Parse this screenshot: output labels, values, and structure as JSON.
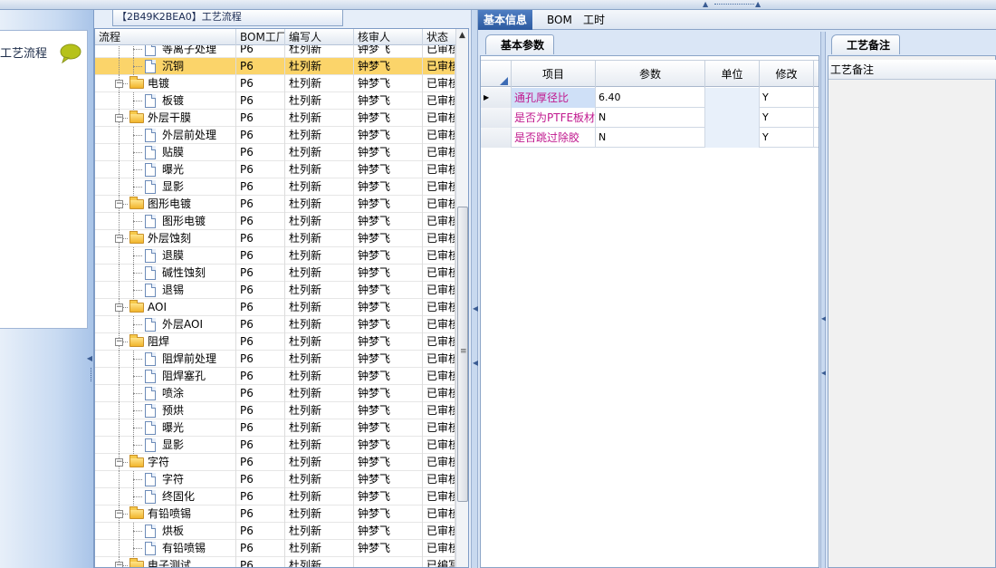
{
  "left_panel": {
    "title": "工艺流程",
    "icon": "speech-bubble-icon"
  },
  "tree_panel": {
    "header": "【2B49K2BEA0】工艺流程",
    "columns": [
      "流程",
      "BOM工厂",
      "编写人",
      "核审人",
      "状态"
    ],
    "rows": [
      {
        "level": 1,
        "type": "doc",
        "name": "等离子处理",
        "bom": "P6",
        "writer": "杜列新",
        "reviewer": "钟梦飞",
        "status": "已审核"
      },
      {
        "level": 1,
        "type": "doc",
        "name": "沉铜",
        "bom": "P6",
        "writer": "杜列新",
        "reviewer": "钟梦飞",
        "status": "已审核",
        "selected": true
      },
      {
        "level": 0,
        "type": "folder",
        "name": "电镀",
        "bom": "P6",
        "writer": "杜列新",
        "reviewer": "钟梦飞",
        "status": "已审核"
      },
      {
        "level": 1,
        "type": "doc",
        "name": "板镀",
        "bom": "P6",
        "writer": "杜列新",
        "reviewer": "钟梦飞",
        "status": "已审核"
      },
      {
        "level": 0,
        "type": "folder",
        "name": "外层干膜",
        "bom": "P6",
        "writer": "杜列新",
        "reviewer": "钟梦飞",
        "status": "已审核"
      },
      {
        "level": 1,
        "type": "doc",
        "name": "外层前处理",
        "bom": "P6",
        "writer": "杜列新",
        "reviewer": "钟梦飞",
        "status": "已审核"
      },
      {
        "level": 1,
        "type": "doc",
        "name": "贴膜",
        "bom": "P6",
        "writer": "杜列新",
        "reviewer": "钟梦飞",
        "status": "已审核"
      },
      {
        "level": 1,
        "type": "doc",
        "name": "曝光",
        "bom": "P6",
        "writer": "杜列新",
        "reviewer": "钟梦飞",
        "status": "已审核"
      },
      {
        "level": 1,
        "type": "doc",
        "name": "显影",
        "bom": "P6",
        "writer": "杜列新",
        "reviewer": "钟梦飞",
        "status": "已审核"
      },
      {
        "level": 0,
        "type": "folder",
        "name": "图形电镀",
        "bom": "P6",
        "writer": "杜列新",
        "reviewer": "钟梦飞",
        "status": "已审核"
      },
      {
        "level": 1,
        "type": "doc",
        "name": "图形电镀",
        "bom": "P6",
        "writer": "杜列新",
        "reviewer": "钟梦飞",
        "status": "已审核"
      },
      {
        "level": 0,
        "type": "folder",
        "name": "外层蚀刻",
        "bom": "P6",
        "writer": "杜列新",
        "reviewer": "钟梦飞",
        "status": "已审核"
      },
      {
        "level": 1,
        "type": "doc",
        "name": "退膜",
        "bom": "P6",
        "writer": "杜列新",
        "reviewer": "钟梦飞",
        "status": "已审核"
      },
      {
        "level": 1,
        "type": "doc",
        "name": "碱性蚀刻",
        "bom": "P6",
        "writer": "杜列新",
        "reviewer": "钟梦飞",
        "status": "已审核"
      },
      {
        "level": 1,
        "type": "doc",
        "name": "退锡",
        "bom": "P6",
        "writer": "杜列新",
        "reviewer": "钟梦飞",
        "status": "已审核"
      },
      {
        "level": 0,
        "type": "folder",
        "name": "AOI",
        "bom": "P6",
        "writer": "杜列新",
        "reviewer": "钟梦飞",
        "status": "已审核"
      },
      {
        "level": 1,
        "type": "doc",
        "name": "外层AOI",
        "bom": "P6",
        "writer": "杜列新",
        "reviewer": "钟梦飞",
        "status": "已审核"
      },
      {
        "level": 0,
        "type": "folder",
        "name": "阻焊",
        "bom": "P6",
        "writer": "杜列新",
        "reviewer": "钟梦飞",
        "status": "已审核"
      },
      {
        "level": 1,
        "type": "doc",
        "name": "阻焊前处理",
        "bom": "P6",
        "writer": "杜列新",
        "reviewer": "钟梦飞",
        "status": "已审核"
      },
      {
        "level": 1,
        "type": "doc",
        "name": "阻焊塞孔",
        "bom": "P6",
        "writer": "杜列新",
        "reviewer": "钟梦飞",
        "status": "已审核"
      },
      {
        "level": 1,
        "type": "doc",
        "name": "喷涂",
        "bom": "P6",
        "writer": "杜列新",
        "reviewer": "钟梦飞",
        "status": "已审核"
      },
      {
        "level": 1,
        "type": "doc",
        "name": "预烘",
        "bom": "P6",
        "writer": "杜列新",
        "reviewer": "钟梦飞",
        "status": "已审核"
      },
      {
        "level": 1,
        "type": "doc",
        "name": "曝光",
        "bom": "P6",
        "writer": "杜列新",
        "reviewer": "钟梦飞",
        "status": "已审核"
      },
      {
        "level": 1,
        "type": "doc",
        "name": "显影",
        "bom": "P6",
        "writer": "杜列新",
        "reviewer": "钟梦飞",
        "status": "已审核"
      },
      {
        "level": 0,
        "type": "folder",
        "name": "字符",
        "bom": "P6",
        "writer": "杜列新",
        "reviewer": "钟梦飞",
        "status": "已审核"
      },
      {
        "level": 1,
        "type": "doc",
        "name": "字符",
        "bom": "P6",
        "writer": "杜列新",
        "reviewer": "钟梦飞",
        "status": "已审核"
      },
      {
        "level": 1,
        "type": "doc",
        "name": "终固化",
        "bom": "P6",
        "writer": "杜列新",
        "reviewer": "钟梦飞",
        "status": "已审核"
      },
      {
        "level": 0,
        "type": "folder",
        "name": "有铅喷锡",
        "bom": "P6",
        "writer": "杜列新",
        "reviewer": "钟梦飞",
        "status": "已审核"
      },
      {
        "level": 1,
        "type": "doc",
        "name": "烘板",
        "bom": "P6",
        "writer": "杜列新",
        "reviewer": "钟梦飞",
        "status": "已审核"
      },
      {
        "level": 1,
        "type": "doc",
        "name": "有铅喷锡",
        "bom": "P6",
        "writer": "杜列新",
        "reviewer": "钟梦飞",
        "status": "已审核"
      },
      {
        "level": 0,
        "type": "folder",
        "name": "电子测试",
        "bom": "P6",
        "writer": "杜列新",
        "reviewer": "",
        "status": "已编写"
      }
    ]
  },
  "tabs": [
    {
      "label": "基本信息",
      "active": true
    },
    {
      "label": "BOM",
      "active": false
    },
    {
      "label": "工时",
      "active": false
    }
  ],
  "basic_params": {
    "tab_label": "基本参数",
    "columns": [
      "项目",
      "参数",
      "单位",
      "修改"
    ],
    "rows": [
      {
        "item": "通孔厚径比",
        "value": "6.40",
        "unit": "",
        "modify": "Y",
        "current": true
      },
      {
        "item": "是否为PTFE板材",
        "value": "N",
        "unit": "",
        "modify": "Y"
      },
      {
        "item": "是否跳过除胶",
        "value": "N",
        "unit": "",
        "modify": "Y"
      }
    ]
  },
  "notes": {
    "tab_label": "工艺备注",
    "field_label": "工艺备注"
  }
}
